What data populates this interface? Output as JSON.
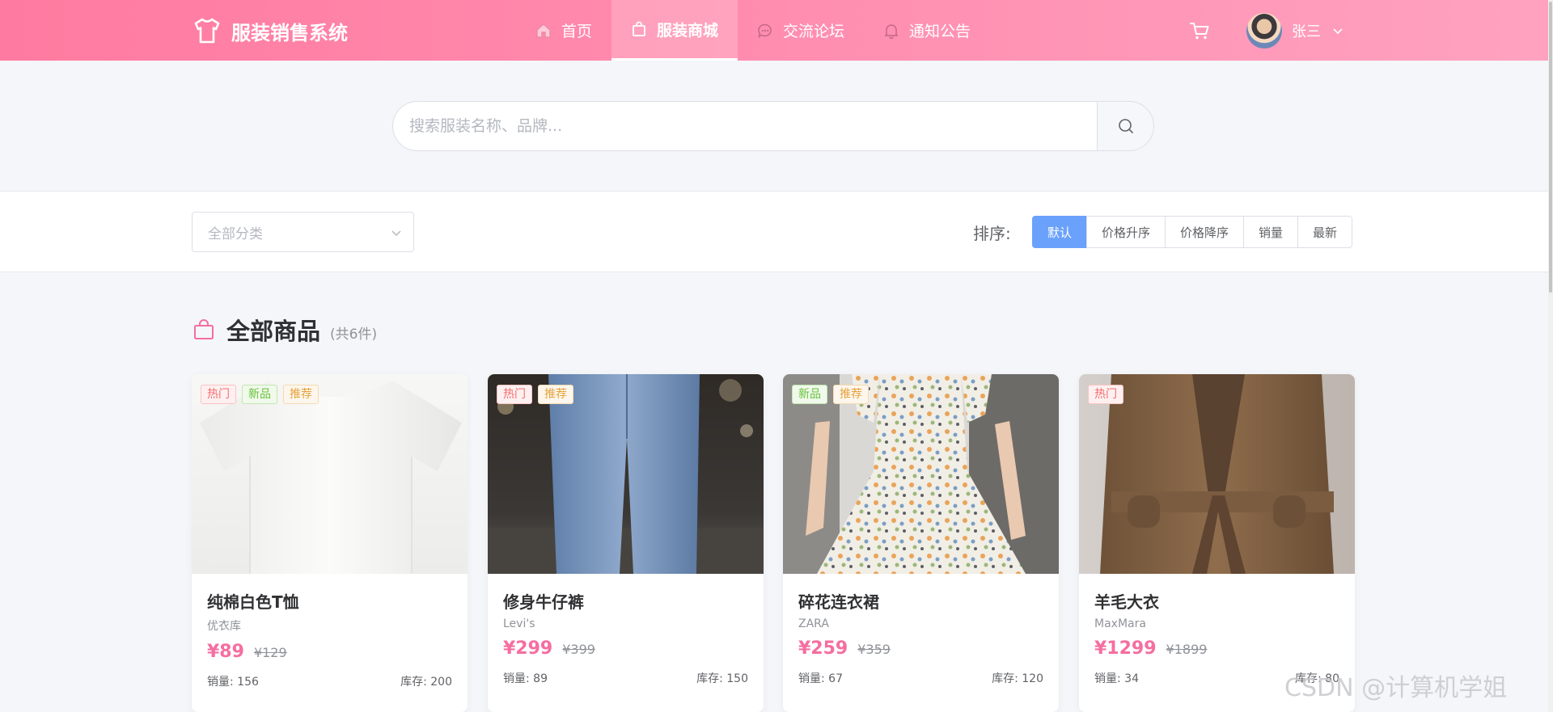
{
  "header": {
    "logo_text": "服装销售系统",
    "nav": [
      {
        "label": "首页",
        "icon": "home-icon",
        "active": false
      },
      {
        "label": "服装商城",
        "icon": "bag-icon",
        "active": true
      },
      {
        "label": "交流论坛",
        "icon": "chat-icon",
        "active": false
      },
      {
        "label": "通知公告",
        "icon": "bell-icon",
        "active": false
      }
    ],
    "user_name": "张三"
  },
  "search": {
    "placeholder": "搜索服装名称、品牌...",
    "value": ""
  },
  "filters": {
    "category_placeholder": "全部分类",
    "sort_label": "排序:",
    "sort_options": [
      "默认",
      "价格升序",
      "价格降序",
      "销量",
      "最新"
    ],
    "sort_active": "默认"
  },
  "section": {
    "title": "全部商品",
    "count": "(共6件)"
  },
  "products": [
    {
      "name": "纯棉白色T恤",
      "brand": "优衣库",
      "price": "¥89",
      "old_price": "¥129",
      "sales": "销量: 156",
      "stock": "库存: 200",
      "tags": [
        "热门",
        "新品",
        "推荐"
      ]
    },
    {
      "name": "修身牛仔裤",
      "brand": "Levi's",
      "price": "¥299",
      "old_price": "¥399",
      "sales": "销量: 89",
      "stock": "库存: 150",
      "tags": [
        "热门",
        "推荐"
      ]
    },
    {
      "name": "碎花连衣裙",
      "brand": "ZARA",
      "price": "¥259",
      "old_price": "¥359",
      "sales": "销量: 67",
      "stock": "库存: 120",
      "tags": [
        "新品",
        "推荐"
      ]
    },
    {
      "name": "羊毛大衣",
      "brand": "MaxMara",
      "price": "¥1299",
      "old_price": "¥1899",
      "sales": "销量: 34",
      "stock": "库存: 80",
      "tags": [
        "热门"
      ]
    }
  ],
  "watermark": "CSDN @计算机学姐",
  "colors": {
    "header_start": "#ff7aa0",
    "header_end": "#ffa2c0",
    "price": "#f56ea0",
    "sort_active": "#6aa1fb"
  }
}
